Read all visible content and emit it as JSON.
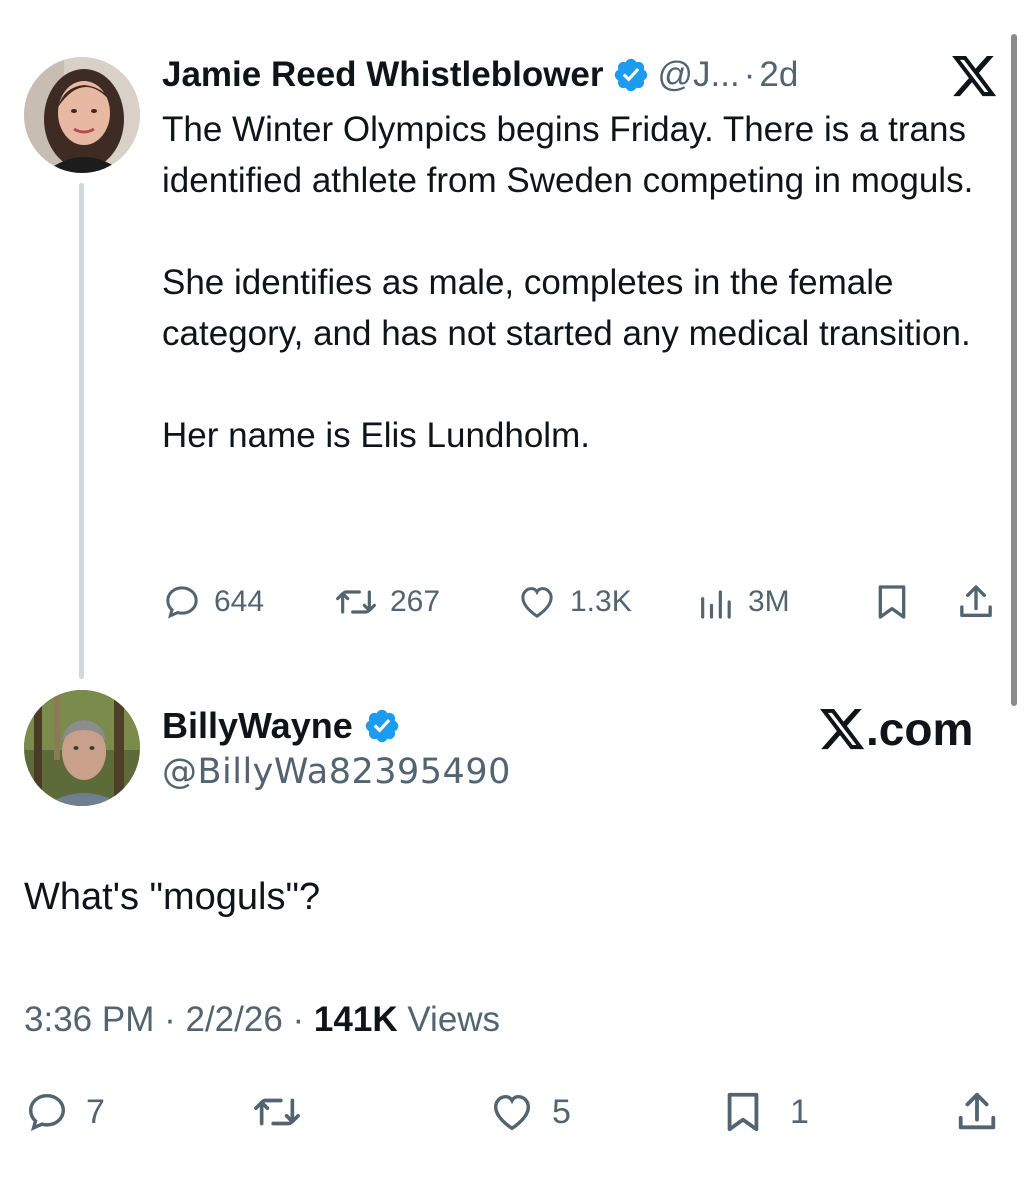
{
  "tweet": {
    "author_name": "Jamie Reed Whistleblower",
    "handle": "@J...",
    "separator": "·",
    "time_ago": "2d",
    "paragraphs": [
      "The Winter Olympics begins Friday. There is a trans identified athlete from Sweden competing in moguls.",
      "She identifies as male, completes in the female category, and has not started any medical transition.",
      "Her name is Elis Lundholm."
    ],
    "stats": {
      "replies": "644",
      "reposts": "267",
      "likes": "1.3K",
      "views": "3M"
    }
  },
  "reply": {
    "author_name": "BillyWayne",
    "handle": "@BillyWa82395490",
    "text": "What's \"moguls\"?",
    "time": "3:36 PM",
    "date": "2/2/26",
    "views_count": "141K",
    "views_label": "Views",
    "separator": "·",
    "stats": {
      "replies": "7",
      "likes": "5",
      "bookmarks": "1"
    }
  },
  "branding": {
    "xcom_label": ".com"
  },
  "colors": {
    "verified": "#1d9bf0",
    "text": "#0f1419",
    "secondary": "#536471",
    "thread_line": "#cfd9de"
  }
}
